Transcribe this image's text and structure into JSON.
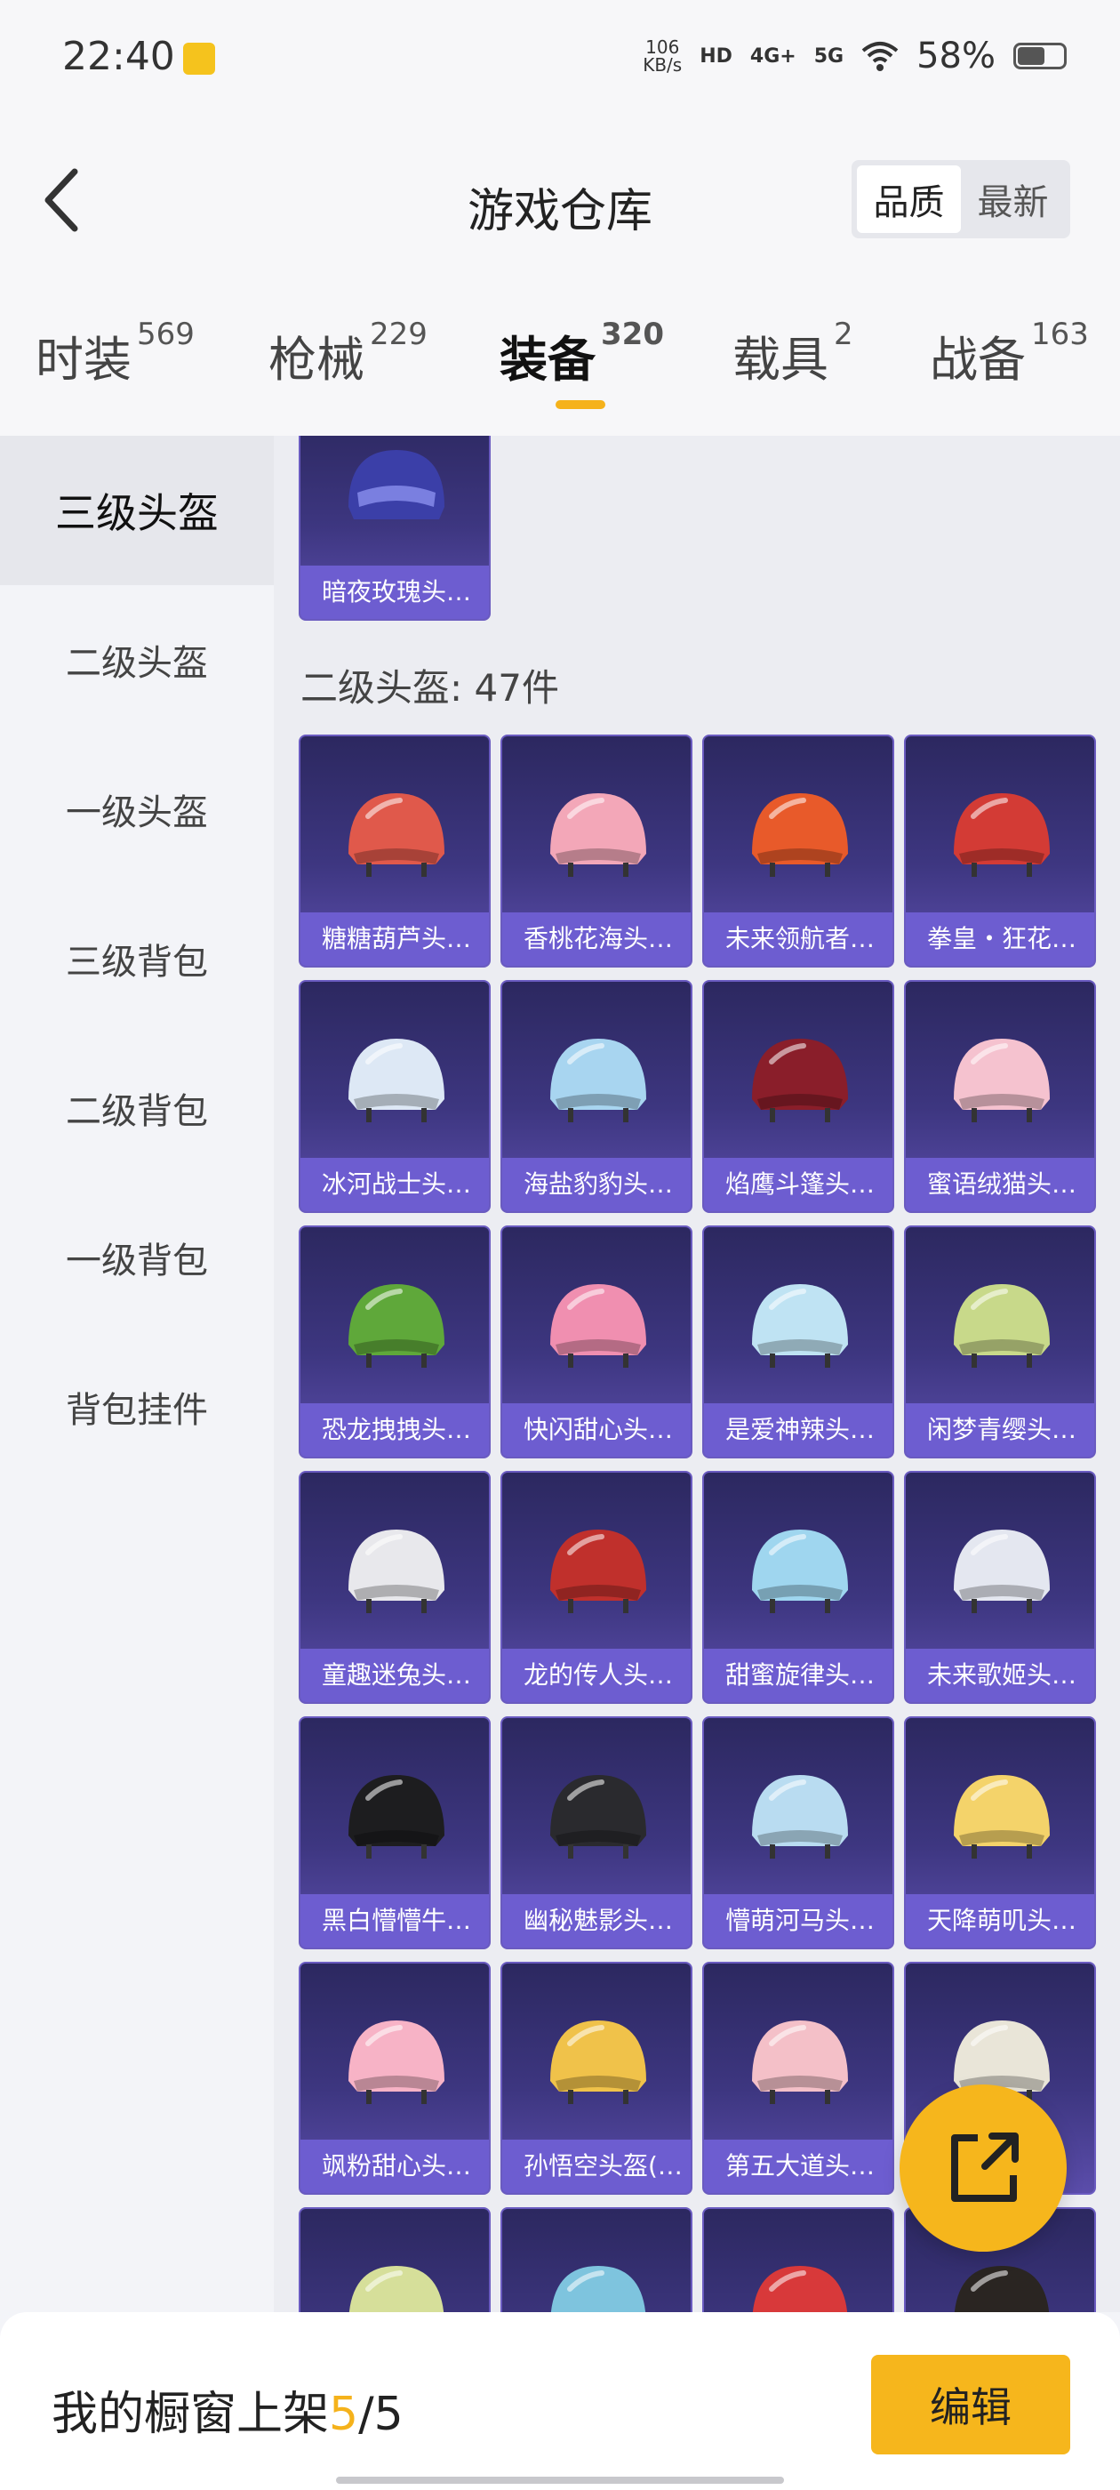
{
  "status_bar": {
    "time": "22:40",
    "net_speed": "106",
    "net_unit": "KB/s",
    "hd_badge": "HD",
    "sig_4g": "4G+",
    "sig_5g": "5G",
    "battery": "58%"
  },
  "header": {
    "title": "游戏仓库",
    "sort_options": [
      "品质",
      "最新"
    ],
    "active_sort": "品质"
  },
  "tabs": [
    {
      "label": "时装",
      "count": "569"
    },
    {
      "label": "枪械",
      "count": "229"
    },
    {
      "label": "装备",
      "count": "320"
    },
    {
      "label": "载具",
      "count": "2"
    },
    {
      "label": "战备",
      "count": "163"
    }
  ],
  "active_tab": "装备",
  "sidebar": {
    "items": [
      "三级头盔",
      "二级头盔",
      "一级头盔",
      "三级背包",
      "二级背包",
      "一级背包",
      "背包挂件"
    ],
    "active": "三级头盔"
  },
  "content": {
    "top_item": "暗夜玫瑰头…",
    "section_label": "二级头盔: 47件",
    "items": [
      {
        "name": "糖糖葫芦头…",
        "color": "#e0594b"
      },
      {
        "name": "香桃花海头…",
        "color": "#f3a7b8"
      },
      {
        "name": "未来领航者…",
        "color": "#e85a2a"
      },
      {
        "name": "拳皇・狂花…",
        "color": "#d33b35"
      },
      {
        "name": "冰河战士头…",
        "color": "#dde8f5"
      },
      {
        "name": "海盐豹豹头…",
        "color": "#a8d5f0"
      },
      {
        "name": "焰鹰斗篷头…",
        "color": "#8a1e2a"
      },
      {
        "name": "蜜语绒猫头…",
        "color": "#f5c2cf"
      },
      {
        "name": "恐龙拽拽头…",
        "color": "#5fa83a"
      },
      {
        "name": "快闪甜心头…",
        "color": "#f08fb0"
      },
      {
        "name": "是爱神辣头…",
        "color": "#bfe3f3"
      },
      {
        "name": "闲梦青缨头…",
        "color": "#c8d98a"
      },
      {
        "name": "童趣迷兔头…",
        "color": "#e8e8ec"
      },
      {
        "name": "龙的传人头…",
        "color": "#c0302c"
      },
      {
        "name": "甜蜜旋律头…",
        "color": "#9fd6ef"
      },
      {
        "name": "未来歌姬头…",
        "color": "#e4e7f0"
      },
      {
        "name": "黑白懵懵牛…",
        "color": "#1d1d1f"
      },
      {
        "name": "幽秘魅影头…",
        "color": "#2a2a2e"
      },
      {
        "name": "懵萌河马头…",
        "color": "#b9dcf1"
      },
      {
        "name": "天降萌叽头…",
        "color": "#f4d36a"
      },
      {
        "name": "飒粉甜心头…",
        "color": "#f7b3c6"
      },
      {
        "name": "孙悟空头盔(…",
        "color": "#f0c24a"
      },
      {
        "name": "第五大道头…",
        "color": "#f4c0c8"
      },
      {
        "name": "",
        "color": "#e9e5d8"
      },
      {
        "name": "",
        "color": "#d6df9a"
      },
      {
        "name": "",
        "color": "#7ec4de"
      },
      {
        "name": "",
        "color": "#d8393a"
      },
      {
        "name": "",
        "color": "#2a2522"
      }
    ]
  },
  "bottom_bar": {
    "label_prefix": "我的橱窗上架",
    "count_current": "5",
    "count_sep": "/",
    "count_total": "5",
    "edit_label": "编辑"
  },
  "icons": {
    "back": "back-arrow-icon",
    "share": "share-icon"
  },
  "colors": {
    "accent": "#f5b21b",
    "card_top": "#2c2860",
    "card_bottom": "#5b4dab"
  }
}
